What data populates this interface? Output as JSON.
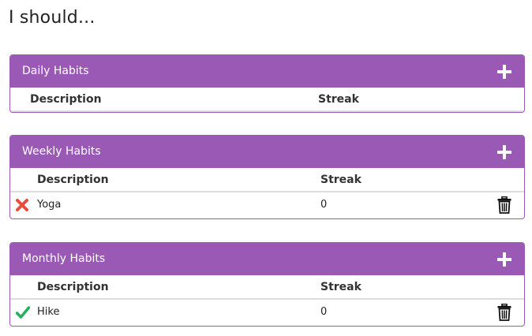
{
  "page": {
    "title": "I should..."
  },
  "panels": [
    {
      "title": "Daily Habits",
      "headers": {
        "description": "Description",
        "streak": "Streak"
      },
      "rows": []
    },
    {
      "title": "Weekly Habits",
      "headers": {
        "description": "Description",
        "streak": "Streak"
      },
      "rows": [
        {
          "status": "x-icon",
          "description": "Yoga",
          "streak": "0"
        }
      ]
    },
    {
      "title": "Monthly Habits",
      "headers": {
        "description": "Description",
        "streak": "Streak"
      },
      "rows": [
        {
          "status": "check-icon",
          "description": "Hike",
          "streak": "0"
        }
      ]
    }
  ],
  "colors": {
    "accent": "#9b59b6",
    "error": "#e74c3c",
    "success": "#27ae60"
  }
}
